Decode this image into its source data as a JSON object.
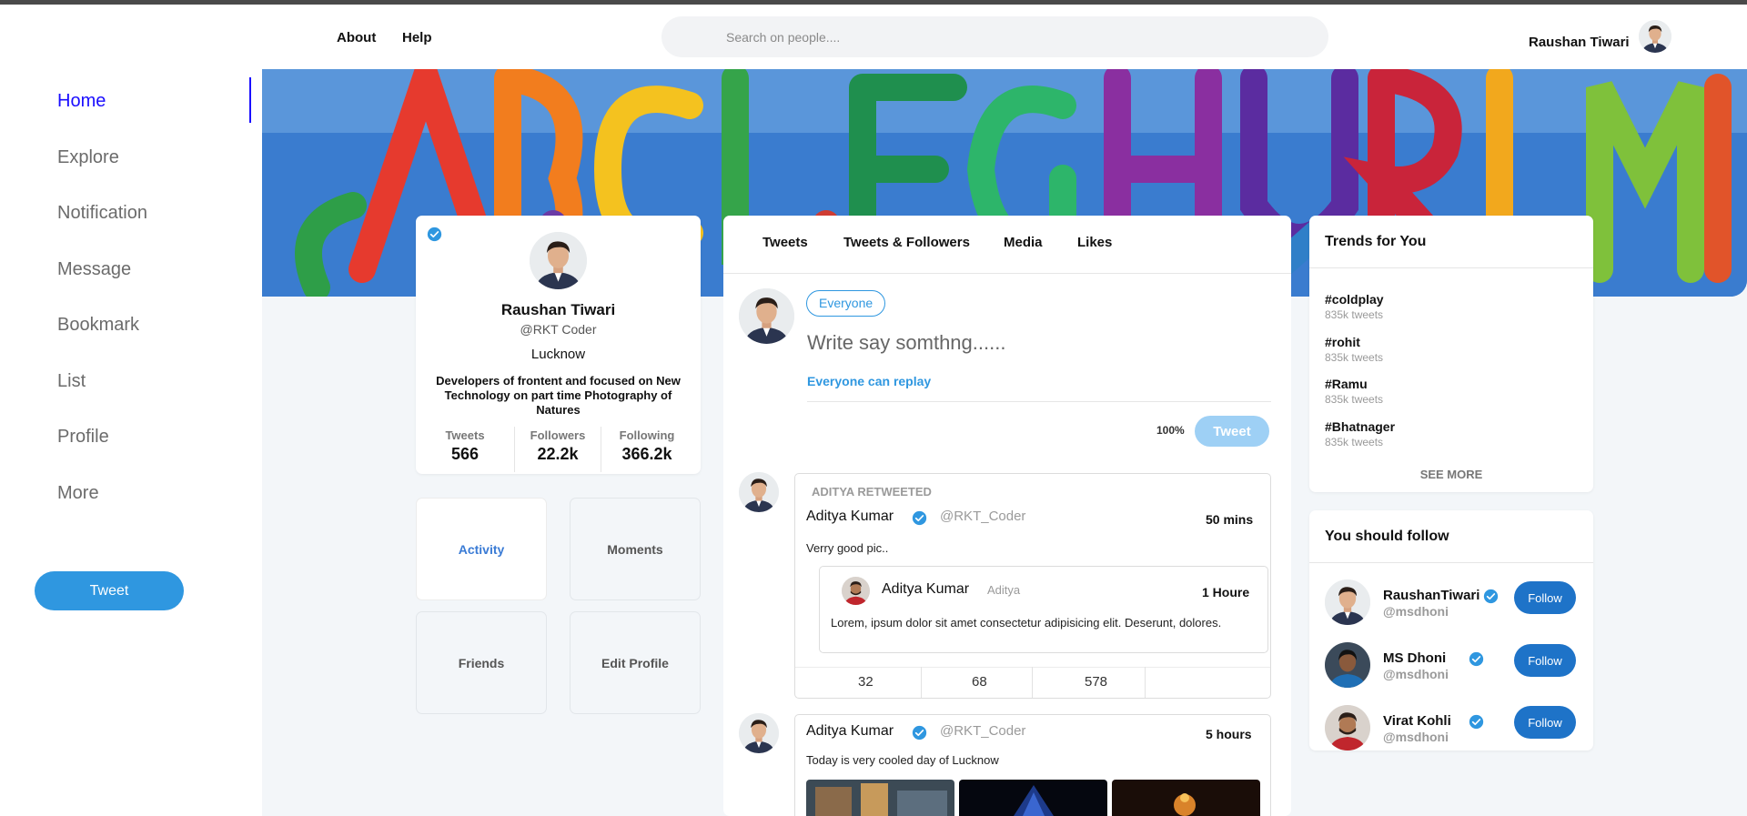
{
  "colors": {
    "accent": "#2f97e0",
    "active_nav": "#1a0dff",
    "follow_button": "#1e73c8",
    "tweet_disabled": "#9ed0f5"
  },
  "header": {
    "links": [
      "About",
      "Help"
    ],
    "search_placeholder": "Search on people....",
    "user_name": "Raushan Tiwari"
  },
  "sidebar": {
    "items": [
      {
        "label": "Home",
        "active": true
      },
      {
        "label": "Explore"
      },
      {
        "label": "Notification"
      },
      {
        "label": "Message"
      },
      {
        "label": "Bookmark"
      },
      {
        "label": "List"
      },
      {
        "label": "Profile"
      },
      {
        "label": "More"
      }
    ],
    "tweet_button": "Tweet"
  },
  "profile": {
    "name": "Raushan Tiwari",
    "handle": "@RKT Coder",
    "location": "Lucknow",
    "bio": "Developers of frontent and focused on New Technology on part time Photography of Natures",
    "stats": [
      {
        "label": "Tweets",
        "value": "566"
      },
      {
        "label": "Followers",
        "value": "22.2k"
      },
      {
        "label": "Following",
        "value": "366.2k"
      }
    ]
  },
  "tiles": [
    "Activity",
    "Moments",
    "Friends",
    "Edit Profile"
  ],
  "feed": {
    "tabs": [
      "Tweets",
      "Tweets & Followers",
      "Media",
      "Likes"
    ],
    "composer": {
      "audience": "Everyone",
      "placeholder": "Write say somthng......",
      "reply_setting": "Everyone can replay",
      "percent": "100%",
      "tweet_button": "Tweet"
    },
    "posts": [
      {
        "retweet_label": "ADITYA RETWEETED",
        "name": "Aditya Kumar",
        "handle": "@RKT_Coder",
        "time": "50 mins",
        "text": "Verry good pic..",
        "quote": {
          "name": "Aditya Kumar",
          "handle": "Aditya",
          "time": "1 Houre",
          "text": "Lorem, ipsum dolor sit amet consectetur adipisicing elit. Deserunt, dolores."
        },
        "actions": [
          "32",
          "68",
          "578"
        ]
      },
      {
        "name": "Aditya Kumar",
        "handle": "@RKT_Coder",
        "time": "5 hours",
        "text": "Today is very cooled day of Lucknow"
      }
    ]
  },
  "trends": {
    "title": "Trends for You",
    "items": [
      {
        "tag": "#coldplay",
        "count": "835k tweets"
      },
      {
        "tag": "#rohit",
        "count": "835k tweets"
      },
      {
        "tag": "#Ramu",
        "count": "835k tweets"
      },
      {
        "tag": "#Bhatnager",
        "count": "835k tweets"
      }
    ],
    "see_more": "SEE MORE"
  },
  "follow": {
    "title": "You should follow",
    "items": [
      {
        "name": "RaushanTiwari",
        "handle": "@msdhoni",
        "button": "Follow"
      },
      {
        "name": "MS Dhoni",
        "handle": "@msdhoni",
        "button": "Follow"
      },
      {
        "name": "Virat Kohli",
        "handle": "@msdhoni",
        "button": "Follow"
      }
    ]
  }
}
